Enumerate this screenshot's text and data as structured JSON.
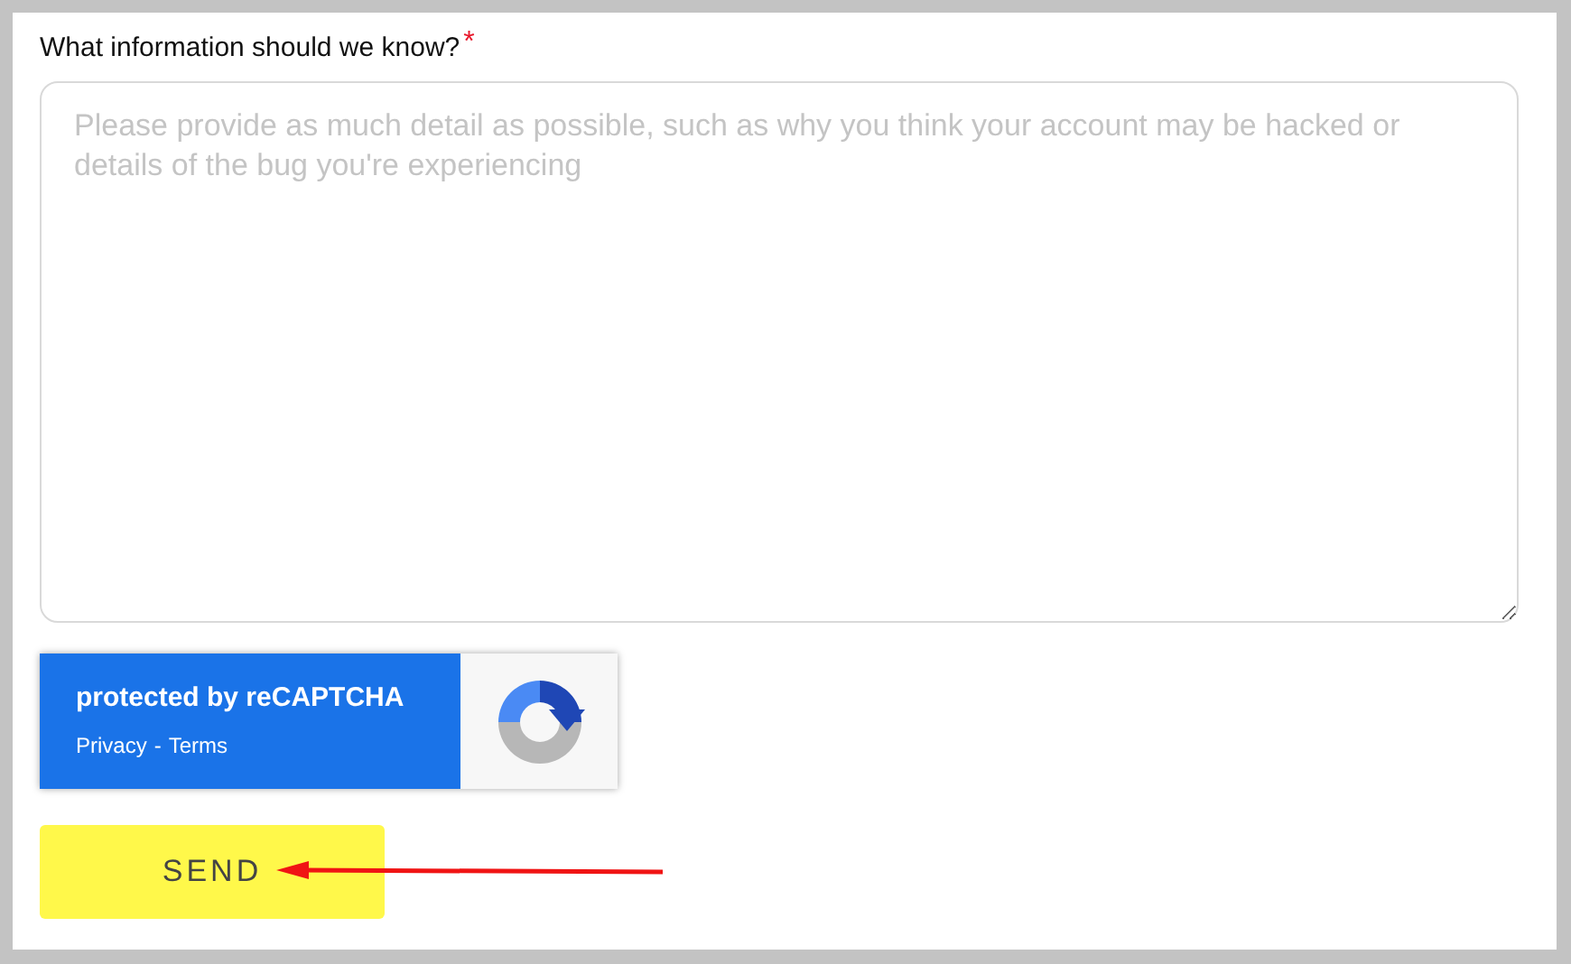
{
  "field": {
    "label": "What information should we know?",
    "required_mark": "*",
    "placeholder": "Please provide as much detail as possible, such as why you think your account may be hacked or details of the bug you're experiencing"
  },
  "recaptcha": {
    "title": "protected by reCAPTCHA",
    "links": [
      "Privacy",
      "Terms"
    ],
    "separator": "-"
  },
  "submit": {
    "label": "SEND"
  }
}
